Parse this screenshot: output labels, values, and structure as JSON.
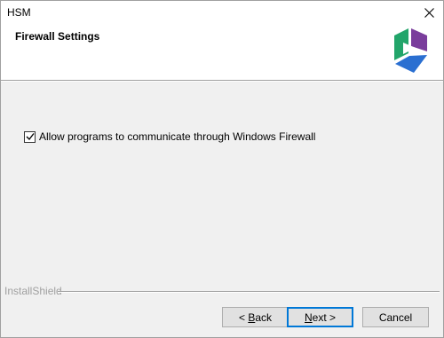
{
  "window": {
    "title": "HSM"
  },
  "header": {
    "title": "Firewall Settings"
  },
  "options": {
    "allow_firewall": {
      "label": "Allow programs to communicate through Windows Firewall",
      "checked": true
    }
  },
  "footer": {
    "brand": "InstallShield"
  },
  "buttons": {
    "back": {
      "pre": "< ",
      "mnemonic": "B",
      "post": "ack"
    },
    "next": {
      "mnemonic": "N",
      "post": "ext >"
    },
    "cancel": {
      "label": "Cancel"
    }
  },
  "icons": {
    "close": "close-icon",
    "logo": "app-logo",
    "check": "checkmark-icon"
  },
  "colors": {
    "accent": "#0078d7",
    "logo_green": "#22a56a",
    "logo_purple": "#7a3d9c",
    "logo_blue": "#2a6fd1"
  }
}
